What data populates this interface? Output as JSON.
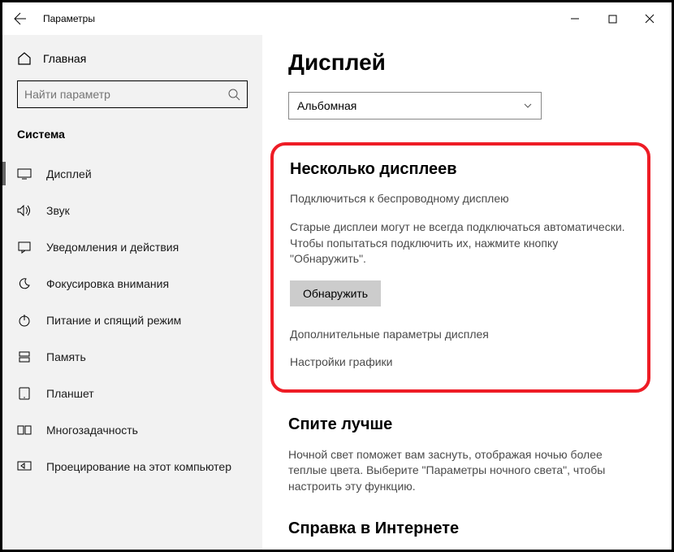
{
  "title": "Параметры",
  "search_placeholder": "Найти параметр",
  "home_label": "Главная",
  "category": "Система",
  "nav": [
    {
      "label": "Дисплей"
    },
    {
      "label": "Звук"
    },
    {
      "label": "Уведомления и действия"
    },
    {
      "label": "Фокусировка внимания"
    },
    {
      "label": "Питание и спящий режим"
    },
    {
      "label": "Память"
    },
    {
      "label": "Планшет"
    },
    {
      "label": "Многозадачность"
    },
    {
      "label": "Проецирование на этот компьютер"
    }
  ],
  "page": {
    "title": "Дисплей",
    "orientation_value": "Альбомная",
    "multi_heading": "Несколько дисплеев",
    "wireless_link": "Подключиться к беспроводному дисплею",
    "detect_hint": "Старые дисплеи могут не всегда подключаться автоматически. Чтобы попытаться подключить их, нажмите кнопку \"Обнаружить\".",
    "detect_btn": "Обнаружить",
    "advanced_link": "Дополнительные параметры дисплея",
    "graphics_link": "Настройки графики",
    "sleep_heading": "Спите лучше",
    "sleep_text": "Ночной свет поможет вам заснуть, отображая ночью более теплые цвета. Выберите \"Параметры ночного света\", чтобы настроить эту функцию.",
    "help_heading": "Справка в Интернете"
  }
}
